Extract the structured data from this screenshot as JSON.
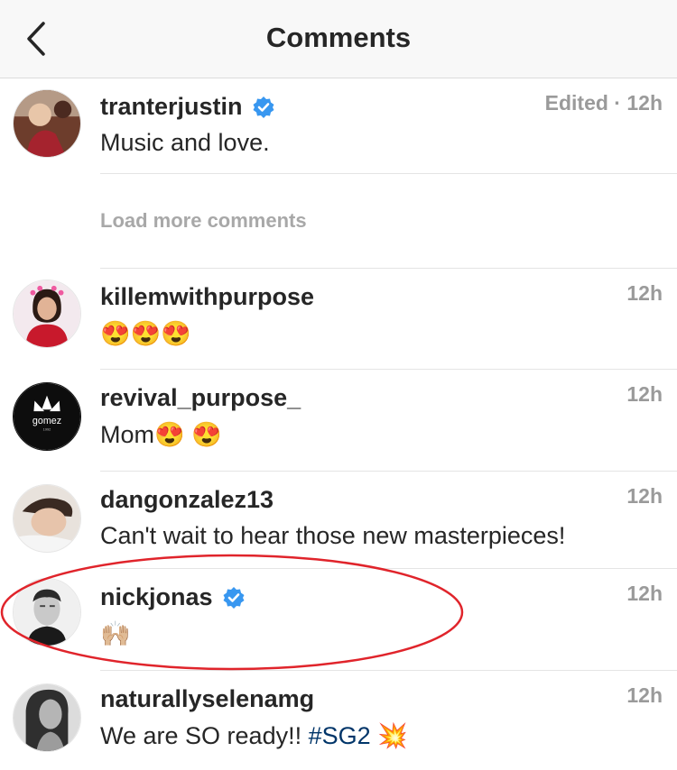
{
  "header": {
    "title": "Comments"
  },
  "caption": {
    "username": "tranterjustin",
    "verified": true,
    "text": "Music and love.",
    "time": "Edited · 12h"
  },
  "load_more_label": "Load more comments",
  "comments": [
    {
      "username": "killemwithpurpose",
      "verified": false,
      "text": "😍😍😍",
      "time": "12h"
    },
    {
      "username": "revival_purpose_",
      "verified": false,
      "text": "Mom😍 😍",
      "time": "12h"
    },
    {
      "username": "dangonzalez13",
      "verified": false,
      "text": "Can't wait to hear those new masterpieces!",
      "time": "12h"
    },
    {
      "username": "nickjonas",
      "verified": true,
      "text": "🙌🏼",
      "time": "12h"
    },
    {
      "username": "naturallyselenamg",
      "verified": false,
      "text_prefix": "We are SO ready!! ",
      "hashtag": "#SG2",
      "text_suffix": " 💥",
      "time": "12h"
    }
  ],
  "avatar_text": {
    "revival_brand": "gomez",
    "revival_year": "1992"
  },
  "colors": {
    "verified": "#3897f0",
    "highlight": "#e0242b",
    "hashtag": "#003569"
  },
  "icons": {
    "back": "chevron-left-icon",
    "verified": "verified-badge-icon"
  }
}
